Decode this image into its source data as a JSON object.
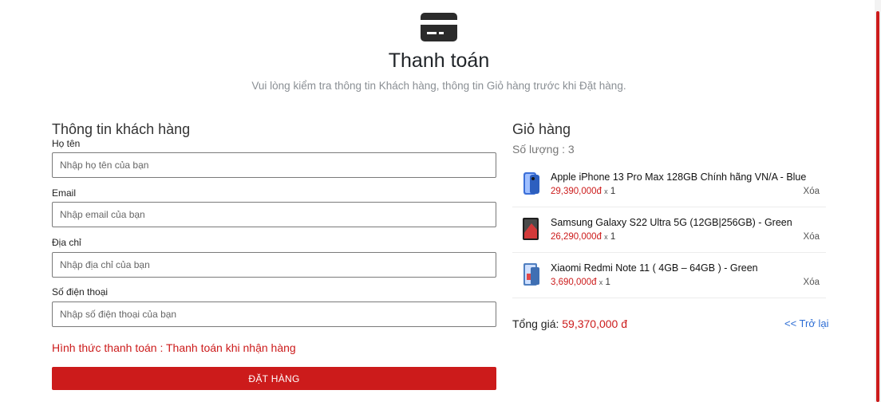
{
  "header": {
    "icon": "credit-card-icon",
    "title": "Thanh toán",
    "subtitle": "Vui lòng kiểm tra thông tin Khách hàng, thông tin Giỏ hàng trước khi Đặt hàng."
  },
  "customer": {
    "section_title": "Thông tin khách hàng",
    "fields": [
      {
        "label": "Họ tên",
        "value": "",
        "placeholder": "Nhập họ tên của bạn"
      },
      {
        "label": "Email",
        "value": "",
        "placeholder": "Nhập email của bạn"
      },
      {
        "label": "Địa chỉ",
        "value": "",
        "placeholder": "Nhập địa chỉ của bạn"
      },
      {
        "label": "Số điện thoại",
        "value": "",
        "placeholder": "Nhập số điện thoại của bạn"
      }
    ],
    "payment_method": "Hình thức thanh toán : Thanh toán khi nhận hàng",
    "order_button": "ĐẶT HÀNG"
  },
  "cart": {
    "section_title": "Giỏ hàng",
    "count_text": "Số lượng : 3",
    "items": [
      {
        "name": "Apple iPhone 13 Pro Max 128GB Chính hãng VN/A - Blue",
        "price": "29,390,000đ",
        "x": "x",
        "qty": "1",
        "remove": "Xóa",
        "thumb_color": "#3b6fd8"
      },
      {
        "name": "Samsung Galaxy S22 Ultra 5G (12GB|256GB) - Green",
        "price": "26,290,000đ",
        "x": "x",
        "qty": "1",
        "remove": "Xóa",
        "thumb_color": "#2a2a2a"
      },
      {
        "name": "Xiaomi Redmi Note 11 ( 4GB – 64GB ) - Green",
        "price": "3,690,000đ",
        "x": "x",
        "qty": "1",
        "remove": "Xóa",
        "thumb_color": "#4f7fc0"
      }
    ],
    "total_label": "Tổng giá:",
    "total_value": "59,370,000 đ",
    "back_link": "<< Trở lại"
  },
  "colors": {
    "accent": "#cc1b1b",
    "link": "#2b6cd4"
  }
}
